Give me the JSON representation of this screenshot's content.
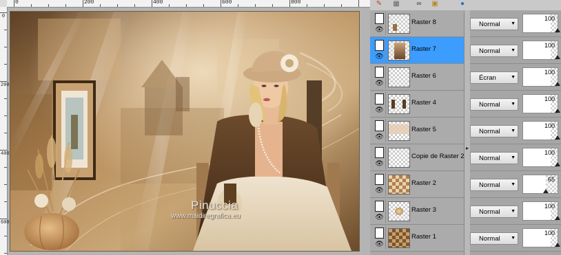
{
  "canvas": {
    "ruler_h_labels": [
      "0",
      "200",
      "400",
      "600",
      "800"
    ],
    "ruler_v_labels": [
      "0",
      "200",
      "400",
      "600"
    ],
    "watermark": {
      "name": "Pinuccia",
      "url": "www.maidiregrafica.eu"
    }
  },
  "palette": {
    "toolbar_icons": [
      "paint-icon",
      "mask-icon",
      "link-icon",
      "lock-icon",
      "globe-icon"
    ],
    "layers": [
      {
        "name": "Raster 8",
        "blend": "Normal",
        "opacity": "100",
        "selected": false
      },
      {
        "name": "Raster 7",
        "blend": "Normal",
        "opacity": "100",
        "selected": true
      },
      {
        "name": "Raster 6",
        "blend": "Écran",
        "opacity": "100",
        "selected": false
      },
      {
        "name": "Raster 4",
        "blend": "Normal",
        "opacity": "100",
        "selected": false
      },
      {
        "name": "Raster 5",
        "blend": "Normal",
        "opacity": "100",
        "selected": false
      },
      {
        "name": "Copie de Raster 2",
        "blend": "Normal",
        "opacity": "100",
        "selected": false
      },
      {
        "name": "Raster 2",
        "blend": "Normal",
        "opacity": "65",
        "selected": false
      },
      {
        "name": "Raster 3",
        "blend": "Normal",
        "opacity": "100",
        "selected": false
      },
      {
        "name": "Raster 1",
        "blend": "Normal",
        "opacity": "100",
        "selected": false
      }
    ]
  },
  "colors": {
    "selected_layer": "#3c9dff",
    "panel_bg": "#a3a3a3"
  }
}
